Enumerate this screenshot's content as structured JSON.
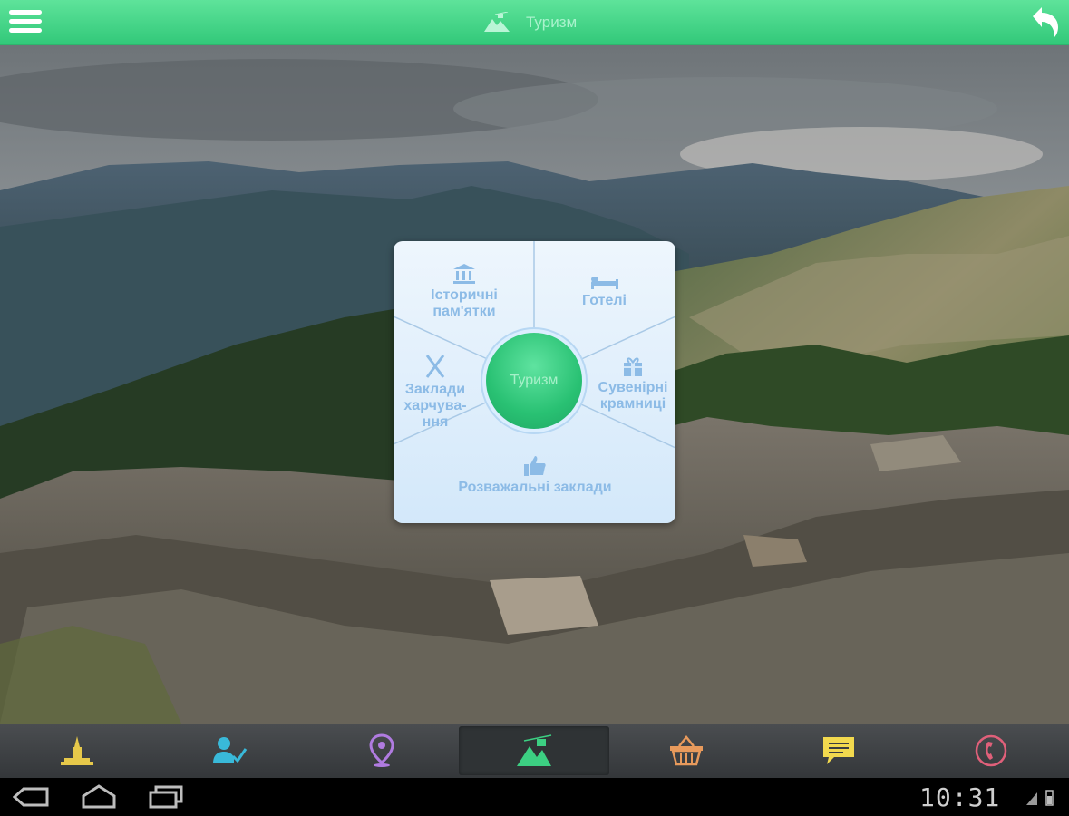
{
  "header": {
    "title": "Туризм",
    "menu_icon": "hamburger-icon",
    "title_icon": "mountain-icon",
    "back_icon": "back-arrow-icon",
    "colors": {
      "bar": "#3ccf82",
      "title_text": "#a9f2cc"
    }
  },
  "tourism_menu": {
    "center_label": "Туризм",
    "segments": {
      "historic": {
        "line1": "Історичні",
        "line2": "пам'ятки",
        "icon": "museum-icon"
      },
      "hotels": {
        "line1": "Готелі",
        "icon": "bed-icon"
      },
      "food": {
        "line1": "Заклади",
        "line2": "харчува-",
        "line3": "ння",
        "icon": "fork-knife-icon"
      },
      "souvenirs": {
        "line1": "Сувенірні",
        "line2": "крамниці",
        "icon": "gift-icon"
      },
      "entertainment": {
        "line1": "Розважальні заклади",
        "icon": "thumbs-up-icon"
      }
    },
    "colors": {
      "text": "#8cbbe6",
      "center": "#29c173"
    }
  },
  "tab_bar": {
    "tabs": [
      {
        "name": "monument",
        "icon": "monument-icon",
        "color": "#e6c84a",
        "active": false
      },
      {
        "name": "person",
        "icon": "person-check-icon",
        "color": "#39b9d9",
        "active": false
      },
      {
        "name": "location",
        "icon": "map-pin-icon",
        "color": "#b07be0",
        "active": false
      },
      {
        "name": "tourism",
        "icon": "mountain-cablecar-icon",
        "color": "#3ccf82",
        "active": true
      },
      {
        "name": "shop",
        "icon": "basket-icon",
        "color": "#e89a5c",
        "active": false
      },
      {
        "name": "messages",
        "icon": "chat-icon",
        "color": "#f2d94e",
        "active": false
      },
      {
        "name": "phone",
        "icon": "phone-icon",
        "color": "#e0607a",
        "active": false
      }
    ]
  },
  "system_bar": {
    "time": "10:31",
    "buttons": [
      "back-nav-icon",
      "home-nav-icon",
      "recents-nav-icon"
    ]
  }
}
